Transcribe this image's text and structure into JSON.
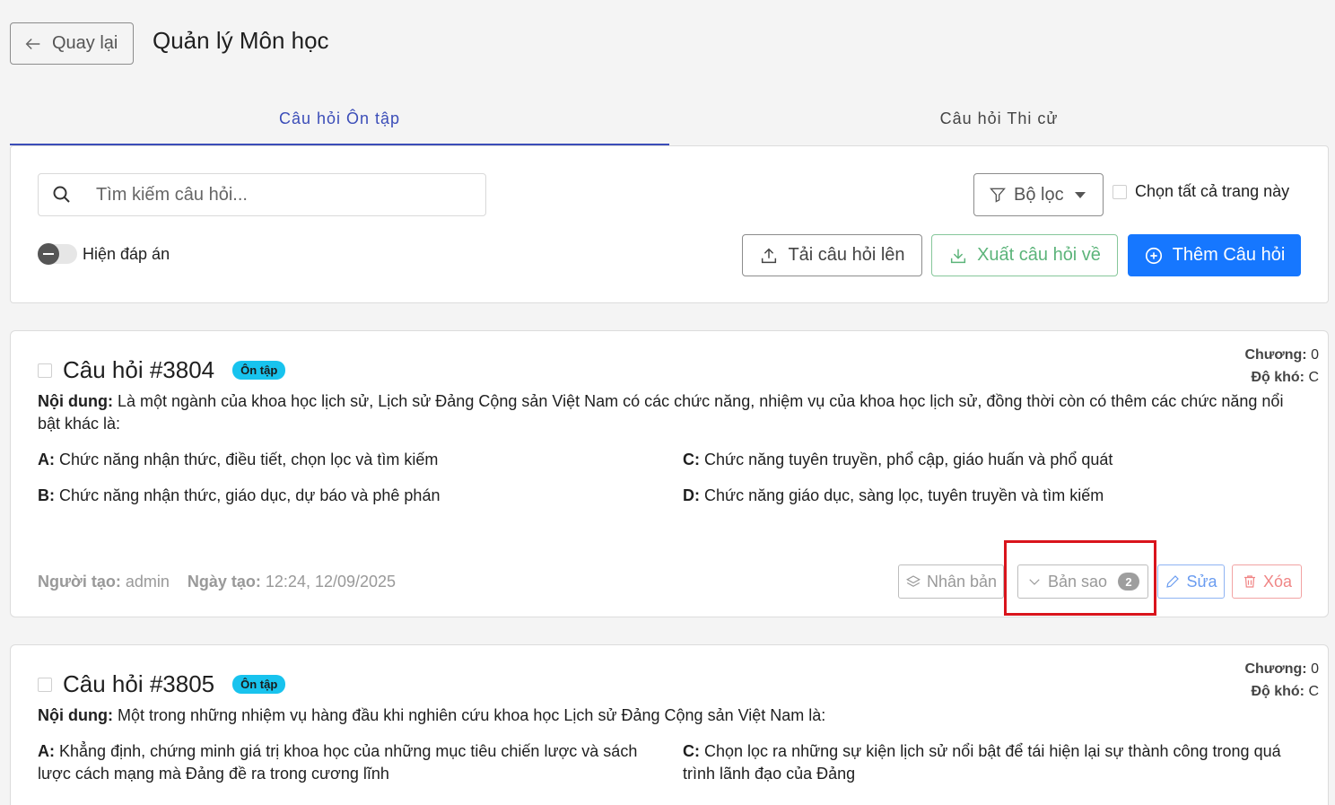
{
  "header": {
    "back_label": "Quay lại",
    "title": "Quản lý Môn học"
  },
  "tabs": [
    {
      "label": "Câu hỏi Ôn tập",
      "active": true
    },
    {
      "label": "Câu hỏi Thi cử",
      "active": false
    }
  ],
  "toolbar": {
    "search_placeholder": "Tìm kiếm câu hỏi...",
    "filter_label": "Bộ lọc",
    "select_all_label": "Chọn tất cả trang này",
    "show_answer_label": "Hiện đáp án",
    "upload_label": "Tải câu hỏi lên",
    "export_label": "Xuất câu hỏi về",
    "add_label": "Thêm Câu hỏi"
  },
  "questions": [
    {
      "title": "Câu hỏi #3804",
      "badge": "Ôn tập",
      "chapter_label": "Chương:",
      "chapter_value": "0",
      "difficulty_label": "Độ khó:",
      "difficulty_value": "C",
      "content_label": "Nội dung:",
      "content": "Là một ngành của khoa học lịch sử, Lịch sử Đảng Cộng sản Việt Nam có các chức năng, nhiệm vụ của khoa học lịch sử, đồng thời còn có thêm các chức năng nổi bật khác là:",
      "options": [
        {
          "key": "A:",
          "text": "Chức năng nhận thức, điều tiết, chọn lọc và tìm kiếm"
        },
        {
          "key": "C:",
          "text": "Chức năng tuyên truyền, phổ cập, giáo huấn và phổ quát"
        },
        {
          "key": "B:",
          "text": "Chức năng nhận thức, giáo dục, dự báo và phê phán"
        },
        {
          "key": "D:",
          "text": "Chức năng giáo dục, sàng lọc, tuyên truyền và tìm kiếm"
        }
      ],
      "creator_label": "Người tạo:",
      "creator": "admin",
      "created_label": "Ngày tạo:",
      "created": "12:24, 12/09/2025",
      "actions": {
        "duplicate": "Nhân bản",
        "copies": "Bản sao",
        "copies_count": "2",
        "edit": "Sửa",
        "delete": "Xóa"
      }
    },
    {
      "title": "Câu hỏi #3805",
      "badge": "Ôn tập",
      "chapter_label": "Chương:",
      "chapter_value": "0",
      "difficulty_label": "Độ khó:",
      "difficulty_value": "C",
      "content_label": "Nội dung:",
      "content": "Một trong những nhiệm vụ hàng đầu khi nghiên cứu khoa học Lịch sử Đảng Cộng sản Việt Nam là:",
      "options": [
        {
          "key": "A:",
          "text": "Khẳng định, chứng minh giá trị khoa học của những mục tiêu chiến lược và sách lược cách mạng mà Đảng đề ra trong cương lĩnh"
        },
        {
          "key": "C:",
          "text": "Chọn lọc ra những sự kiện lịch sử nổi bật để tái hiện lại sự thành công trong quá trình lãnh đạo của Đảng"
        }
      ]
    }
  ],
  "colors": {
    "primary": "#1677ff",
    "tab_active": "#3b4db8",
    "badge": "#18c3ee",
    "highlight": "#d9141c"
  }
}
